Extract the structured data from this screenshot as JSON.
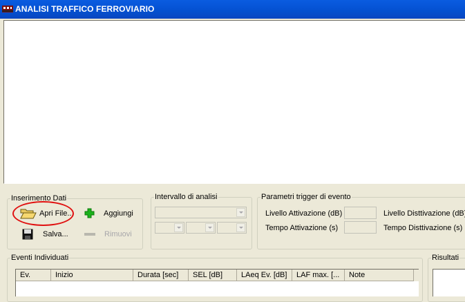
{
  "window": {
    "title": "ANALISI TRAFFICO FERROVIARIO",
    "icon": "train-app-icon"
  },
  "inserimento": {
    "legend": "Inserimento Dati",
    "open_label": "Apri File...",
    "add_label": "Aggiungi",
    "save_label": "Salva...",
    "remove_label": "Rimuovi"
  },
  "intervallo": {
    "legend": "Intervallo di analisi"
  },
  "trigger": {
    "legend": "Parametri trigger di evento",
    "attivazione_label": "Livello Attivazione (dB)",
    "tempo_attivazione_label": "Tempo Attivazione (s)",
    "disattivazione_label": "Livello Disttivazione (dB)",
    "tempo_disattivazione_label": "Tempo Disttivazione (s)"
  },
  "eventi": {
    "legend": "Eventi Individuati",
    "columns": [
      "Ev.",
      "Inizio",
      "Durata [sec]",
      "SEL [dB]",
      "LAeq Ev. [dB]",
      "LAF max. [...",
      "Note"
    ]
  },
  "risultati": {
    "legend": "Risultati"
  },
  "colors": {
    "titlebar": "#0654d6",
    "highlight_oval": "#e01010",
    "add_icon": "#1cb21c"
  }
}
